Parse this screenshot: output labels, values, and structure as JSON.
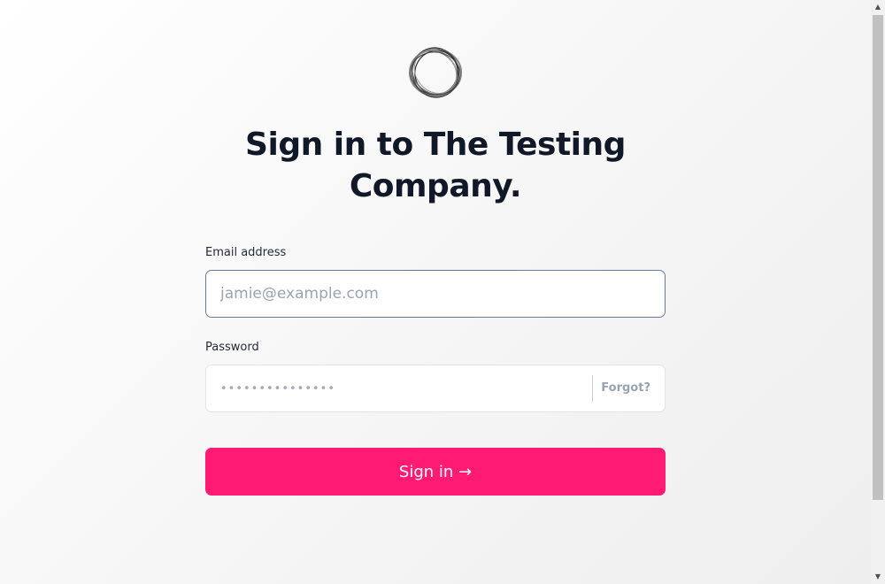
{
  "brand": {
    "logo_icon": "ring-logo-icon",
    "title": "Sign in to The Testing Company."
  },
  "form": {
    "email_label": "Email address",
    "email_placeholder": "jamie@example.com",
    "email_value": "",
    "password_label": "Password",
    "password_placeholder": "•••••••••••••••",
    "forgot_label": "Forgot?",
    "submit_label": "Sign in →"
  },
  "colors": {
    "accent": "#ff1a73",
    "text": "#111827",
    "muted": "#9aa3b2",
    "focus_border": "#6b7a93"
  },
  "scrollbar": {
    "up_icon": "scroll-up-arrow-icon",
    "down_icon": "scroll-down-arrow-icon"
  }
}
